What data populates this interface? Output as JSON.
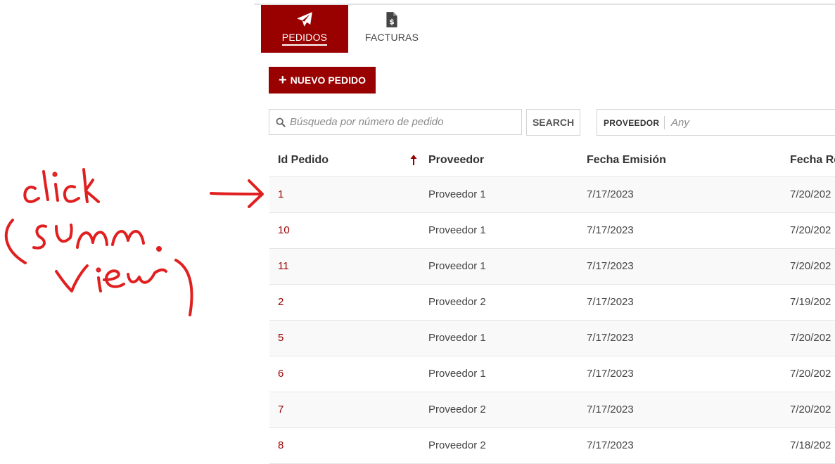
{
  "tabs": [
    {
      "label": "PEDIDOS",
      "icon": "paper-plane-icon",
      "active": true
    },
    {
      "label": "FACTURAS",
      "icon": "invoice-dollar-icon",
      "active": false
    }
  ],
  "actions": {
    "new_order_label": "NUEVO PEDIDO"
  },
  "search": {
    "placeholder": "Búsqueda por número de pedido",
    "value": "",
    "button_label": "SEARCH"
  },
  "filter": {
    "label": "PROVEEDOR",
    "value": "Any"
  },
  "table": {
    "columns": [
      "Id Pedido",
      "Proveedor",
      "Fecha Emisión",
      "Fecha Re"
    ],
    "sort_column": "Id Pedido",
    "sort_direction": "asc",
    "rows": [
      {
        "id": "1",
        "proveedor": "Proveedor 1",
        "emision": "7/17/2023",
        "recepcion": "7/20/202"
      },
      {
        "id": "10",
        "proveedor": "Proveedor 1",
        "emision": "7/17/2023",
        "recepcion": "7/20/202"
      },
      {
        "id": "11",
        "proveedor": "Proveedor 1",
        "emision": "7/17/2023",
        "recepcion": "7/20/202"
      },
      {
        "id": "2",
        "proveedor": "Proveedor 2",
        "emision": "7/17/2023",
        "recepcion": "7/19/202"
      },
      {
        "id": "5",
        "proveedor": "Proveedor 1",
        "emision": "7/17/2023",
        "recepcion": "7/20/202"
      },
      {
        "id": "6",
        "proveedor": "Proveedor 1",
        "emision": "7/17/2023",
        "recepcion": "7/20/202"
      },
      {
        "id": "7",
        "proveedor": "Proveedor 2",
        "emision": "7/17/2023",
        "recepcion": "7/20/202"
      },
      {
        "id": "8",
        "proveedor": "Proveedor 2",
        "emision": "7/17/2023",
        "recepcion": "7/18/202"
      }
    ]
  },
  "annotation": {
    "text": "click (summ view)",
    "color": "#e02020"
  },
  "colors": {
    "brand": "#990000",
    "row_alt": "#f9f9f9",
    "border": "#d4d4d4"
  }
}
